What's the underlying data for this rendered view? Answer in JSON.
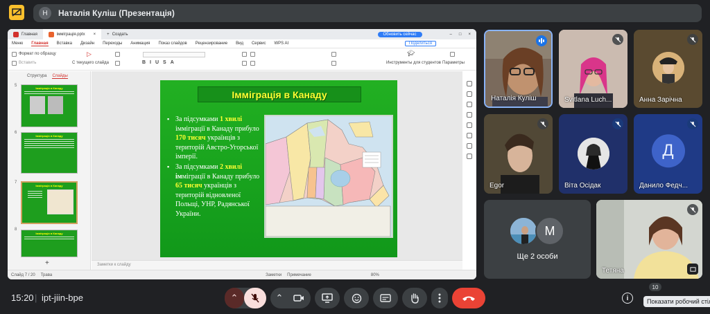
{
  "topbar": {
    "presenter_initial": "Н",
    "title": "Наталія Куліш (Презентація)"
  },
  "shared_window": {
    "tabs": [
      {
        "label": "Главная"
      },
      {
        "label": "імміграція.pptx"
      },
      {
        "label": "Создать"
      }
    ],
    "update_button": "Обновить сейчас",
    "menu": [
      "Меню",
      "Главная",
      "Вставка",
      "Дизайн",
      "Переходы",
      "Анимация",
      "Показ слайдов",
      "Рецензирование",
      "Вид",
      "Сервис",
      "WPS AI"
    ],
    "share_button": "Поделиться",
    "ribbon": {
      "format_painter": "Формат по образцу",
      "paste": "Вставить",
      "from_current": "С текущего слайда",
      "student_tools": "Инструменты для студентов",
      "parameters": "Параметры"
    },
    "left_panel": {
      "tab_structure": "Структура",
      "tab_slides": "Слайды",
      "thumbs": [
        {
          "num": "5",
          "title": "Імміграція в Канаду"
        },
        {
          "num": "6",
          "title": "Імміграція в Канаду"
        },
        {
          "num": "7",
          "title": "Імміграція в Канаду"
        },
        {
          "num": "8",
          "title": "Імміграція в Канаду"
        }
      ]
    },
    "slide": {
      "title": "Імміграція в Канаду",
      "bullet1": {
        "p1": "За підсумками ",
        "h1": "1 хвилі",
        "p2": " імміграції в Канаду прибуло ",
        "h2": "170",
        "p3": " ",
        "h3": "тисяч",
        "p4": " українців з територій Австро-Угорської імперії."
      },
      "bullet2": {
        "p1": "За підсумками ",
        "h1": "2 хвилі",
        "p2": " ",
        "h2": "ім",
        "p3": "міграції в Канаду прибуло ",
        "h3": "65 тисяч",
        "p4": " українців з територій відновленої Польщі, УНР, Радянської України."
      }
    },
    "notes_placeholder": "Заметки к слайду",
    "status": {
      "slide_counter": "Слайд 7 / 20",
      "theme": "Трава",
      "notes": "Заметки",
      "comment": "Примечание",
      "zoom": "80%"
    }
  },
  "participants": [
    {
      "name": "Наталія Куліш",
      "speaking": true
    },
    {
      "name": "Svitlana Luch...",
      "muted": true
    },
    {
      "name": "Анна Зарічна",
      "muted": true
    },
    {
      "name": "Egor",
      "muted": true
    },
    {
      "name": "Віта Осідак",
      "muted": true
    },
    {
      "name": "Данило Федч...",
      "initial": "Д",
      "muted": true
    },
    {
      "name": "Тетяна",
      "muted": true
    }
  ],
  "others": {
    "label": "Ще 2 особи",
    "initial": "M"
  },
  "bottombar": {
    "time": "15:20",
    "separator": "|",
    "meeting_code": "ipt-jiin-bpe",
    "participant_count": "10",
    "tooltip": "Показати робочий стіл"
  },
  "colors": {
    "background": "#202124",
    "end_call": "#ea4335",
    "mic_off": "#f9dedc",
    "slide_green": "#1ea51e",
    "slide_title": "#ffff33",
    "accent_blue": "#1a73e8"
  }
}
